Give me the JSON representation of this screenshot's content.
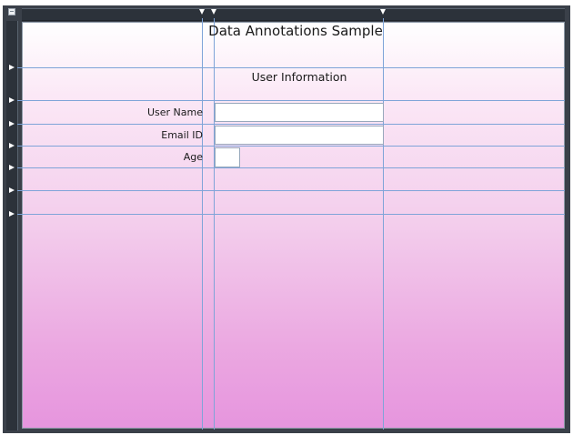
{
  "window": {
    "design_surface": "WPF designer",
    "title": "Data Annotations Sample"
  },
  "form": {
    "section_heading": "User Information",
    "fields": [
      {
        "label": "User Name",
        "value": ""
      },
      {
        "label": "Email ID",
        "value": ""
      },
      {
        "label": "Age",
        "value": ""
      }
    ]
  },
  "colors": {
    "frame": "#3a4049",
    "gridline": "#7fa4d8",
    "gradient_top": "#ffffff",
    "gradient_bottom": "#e695de"
  },
  "icons": [
    "grid-toggle-icon",
    "row-marker-icon",
    "column-marker-icon"
  ]
}
